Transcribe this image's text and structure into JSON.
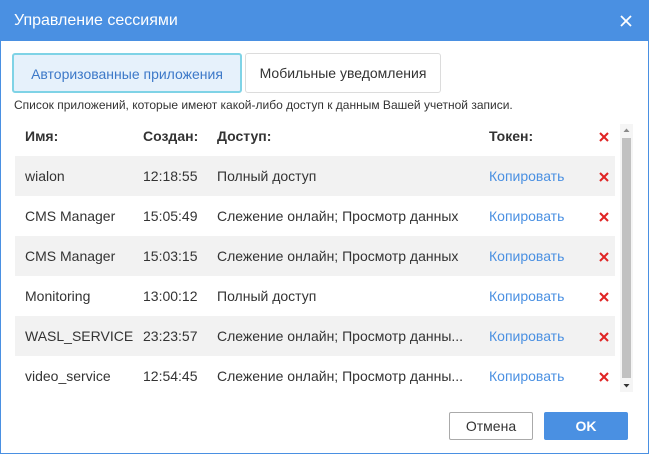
{
  "dialog": {
    "title": "Управление сессиями"
  },
  "tabs": [
    {
      "label": "Авторизованные приложения",
      "active": true
    },
    {
      "label": "Мобильные уведомления",
      "active": false
    }
  ],
  "description": "Список приложений, которые имеют какой-либо доступ к данным Вашей учетной записи.",
  "table": {
    "headers": {
      "name": "Имя:",
      "created": "Создан:",
      "access": "Доступ:",
      "token": "Токен:"
    },
    "rows": [
      {
        "name": "wialon",
        "created": "12:18:55",
        "access": "Полный доступ",
        "token": "Копировать"
      },
      {
        "name": "CMS Manager",
        "created": "15:05:49",
        "access": "Слежение онлайн; Просмотр данных",
        "token": "Копировать"
      },
      {
        "name": "CMS Manager",
        "created": "15:03:15",
        "access": "Слежение онлайн; Просмотр данных",
        "token": "Копировать"
      },
      {
        "name": "Monitoring",
        "created": "13:00:12",
        "access": "Полный доступ",
        "token": "Копировать"
      },
      {
        "name": "WASL_SERVICE",
        "created": "23:23:57",
        "access": "Слежение онлайн; Просмотр данны...",
        "token": "Копировать"
      },
      {
        "name": "video_service",
        "created": "12:54:45",
        "access": "Слежение онлайн; Просмотр данны...",
        "token": "Копировать"
      }
    ]
  },
  "buttons": {
    "cancel": "Отмена",
    "ok": "OK"
  },
  "colors": {
    "accent": "#4a90e2",
    "delete": "#e02424",
    "active_tab_bg": "#e6f1fb",
    "active_tab_border": "#7fd3e6"
  },
  "icons": {
    "close": "close-icon",
    "delete": "delete-icon",
    "scroll_up": "scroll-up-arrow-icon",
    "scroll_down": "scroll-down-arrow-icon"
  }
}
